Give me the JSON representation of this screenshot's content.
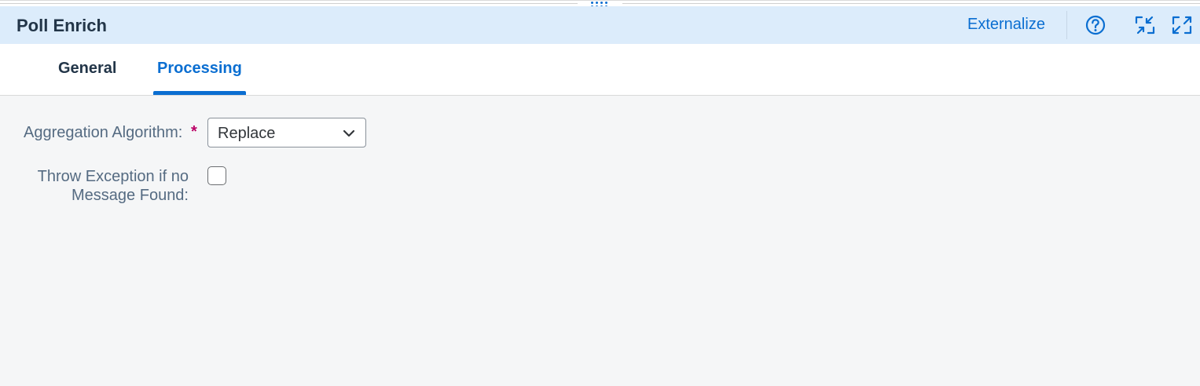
{
  "header": {
    "title": "Poll Enrich",
    "externalize_label": "Externalize",
    "icons": [
      "help-icon",
      "exit-fullscreen-icon",
      "fullscreen-icon"
    ]
  },
  "tabs": [
    {
      "label": "General",
      "active": false
    },
    {
      "label": "Processing",
      "active": true
    }
  ],
  "form": {
    "aggregation_label": "Aggregation Algorithm:",
    "aggregation_required": "*",
    "aggregation_value": "Replace",
    "throw_exception_label": "Throw Exception if no Message Found:",
    "throw_exception_checked": false
  },
  "colors": {
    "accent": "#0a6ed1",
    "header_bg": "#dcecfb",
    "required": "#bb0066",
    "title_text": "#223548"
  }
}
